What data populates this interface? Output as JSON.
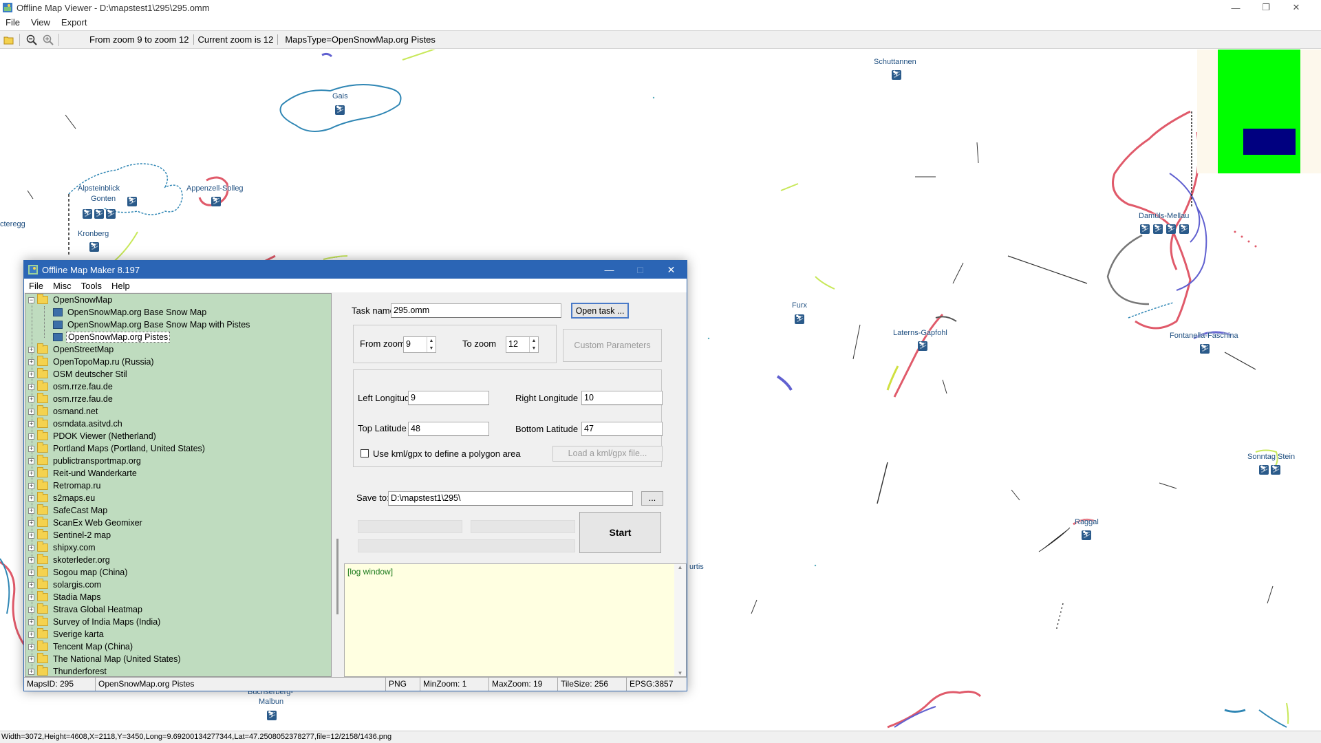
{
  "viewer": {
    "title": "Offline Map Viewer - D:\\mapstest1\\295\\295.omm",
    "menu": [
      "File",
      "View",
      "Export"
    ],
    "toolbar": {
      "zoom_range": "From zoom 9 to zoom 12",
      "current_zoom": "Current zoom is 12",
      "maps_type": "MapsType=OpenSnowMap.org Pistes",
      "icons": [
        "open-folder-icon",
        "zoom-out-icon",
        "zoom-in-icon"
      ]
    },
    "status": "Width=3072,Height=4608,X=2118,Y=3450,Long=9.69200134277344,Lat=47.2508052378277,file=12/2158/1436.png",
    "map_labels": {
      "gais": "Gais",
      "schuttannen": "Schuttannen",
      "alpsteinblick": "Alpsteinblick",
      "gonten": "Gonten",
      "appenzell": "Appenzell-Solleg",
      "kronberg": "Kronberg",
      "egg": "cteregg",
      "damuels": "Damüls-Mellau",
      "furx": "Furx",
      "laterns": "Laterns-Gapfohl",
      "fontanella": "Fontanella-Faschina",
      "sonntag": "Sonntag Stein",
      "raggal": "Raggal",
      "buchserberg": "Buchserberg-",
      "malbun": "Malbun",
      "urtis": "urtis"
    },
    "colors": {
      "minimap_fill": "#00ff00",
      "minimap_view": "#000080"
    }
  },
  "dialog": {
    "title": "Offline Map Maker 8.197",
    "menu": [
      "File",
      "Misc",
      "Tools",
      "Help"
    ],
    "tree": {
      "root": "OpenSnowMap",
      "children": [
        "OpenSnowMap.org Base Snow Map",
        "OpenSnowMap.org Base Snow Map with Pistes",
        "OpenSnowMap.org Pistes"
      ],
      "selected": "OpenSnowMap.org Pistes",
      "folders": [
        "OpenStreetMap",
        "OpenTopoMap.ru (Russia)",
        "OSM deutscher Stil",
        "osm.rrze.fau.de",
        "osm.rrze.fau.de",
        "osmand.net",
        "osmdata.asitvd.ch",
        "PDOK Viewer (Netherland)",
        "Portland Maps (Portland, United States)",
        "publictransportmap.org",
        "Reit-und Wanderkarte",
        "Retromap.ru",
        "s2maps.eu",
        "SafeCast Map",
        "ScanEx Web Geomixer",
        "Sentinel-2 map",
        "shipxy.com",
        "skoterleder.org",
        "Sogou map (China)",
        "solargis.com",
        "Stadia Maps",
        "Strava Global Heatmap",
        "Survey of India Maps (India)",
        "Sverige karta",
        "Tencent Map (China)",
        "The National Map (United States)",
        "Thunderforest"
      ]
    },
    "form": {
      "task_name_label": "Task name",
      "task_name_value": "295.omm",
      "open_task_button": "Open task ...",
      "from_zoom_label": "From zoom",
      "from_zoom_value": "9",
      "to_zoom_label": "To zoom",
      "to_zoom_value": "12",
      "custom_params_button": "Custom Parameters",
      "left_lon_label": "Left Longitude",
      "left_lon_value": "9",
      "right_lon_label": "Right Longitude",
      "right_lon_value": "10",
      "top_lat_label": "Top Latitude",
      "top_lat_value": "48",
      "bottom_lat_label": "Bottom Latitude",
      "bottom_lat_value": "47",
      "kml_checkbox_label": "Use kml/gpx to define a polygon area",
      "kml_checked": false,
      "load_kml_button": "Load a kml/gpx file...",
      "save_to_label": "Save to:",
      "save_to_value": "D:\\mapstest1\\295\\",
      "browse_button": "...",
      "start_button": "Start",
      "log_text": "[log window]"
    },
    "status": {
      "maps_id": "MapsID: 295",
      "map_name": "OpenSnowMap.org Pistes",
      "format": "PNG",
      "min_zoom": "MinZoom: 1",
      "max_zoom": "MaxZoom: 19",
      "tile_size": "TileSize: 256",
      "epsg": "EPSG:3857"
    }
  }
}
